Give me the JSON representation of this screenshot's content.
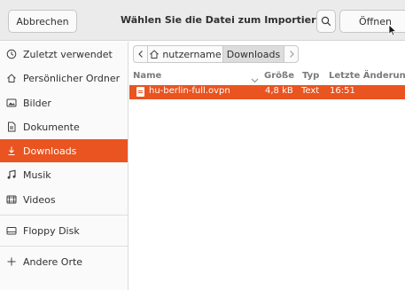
{
  "header": {
    "cancel_label": "Abbrechen",
    "title": "Wählen Sie die Datei zum Importieren",
    "open_label": "Öffnen"
  },
  "sidebar": {
    "items": [
      {
        "label": "Zuletzt verwendet",
        "icon": "clock-icon"
      },
      {
        "label": "Persönlicher Ordner",
        "icon": "home-icon"
      },
      {
        "label": "Bilder",
        "icon": "image-icon"
      },
      {
        "label": "Dokumente",
        "icon": "document-icon"
      },
      {
        "label": "Downloads",
        "icon": "download-icon",
        "active": true
      },
      {
        "label": "Musik",
        "icon": "music-icon"
      },
      {
        "label": "Videos",
        "icon": "video-icon"
      },
      {
        "label": "Floppy Disk",
        "icon": "drive-icon"
      },
      {
        "label": "Andere Orte",
        "icon": "plus-icon"
      }
    ]
  },
  "pathbar": {
    "home": "nutzername",
    "current": "Downloads"
  },
  "columns": {
    "name": "Name",
    "size": "Größe",
    "type": "Typ",
    "modified": "Letzte Änderung"
  },
  "files": [
    {
      "name": "hu-berlin-full.ovpn",
      "size": "4,8 kB",
      "type": "Text",
      "modified": "16:51",
      "selected": true
    }
  ],
  "colors": {
    "accent": "#e95420"
  }
}
